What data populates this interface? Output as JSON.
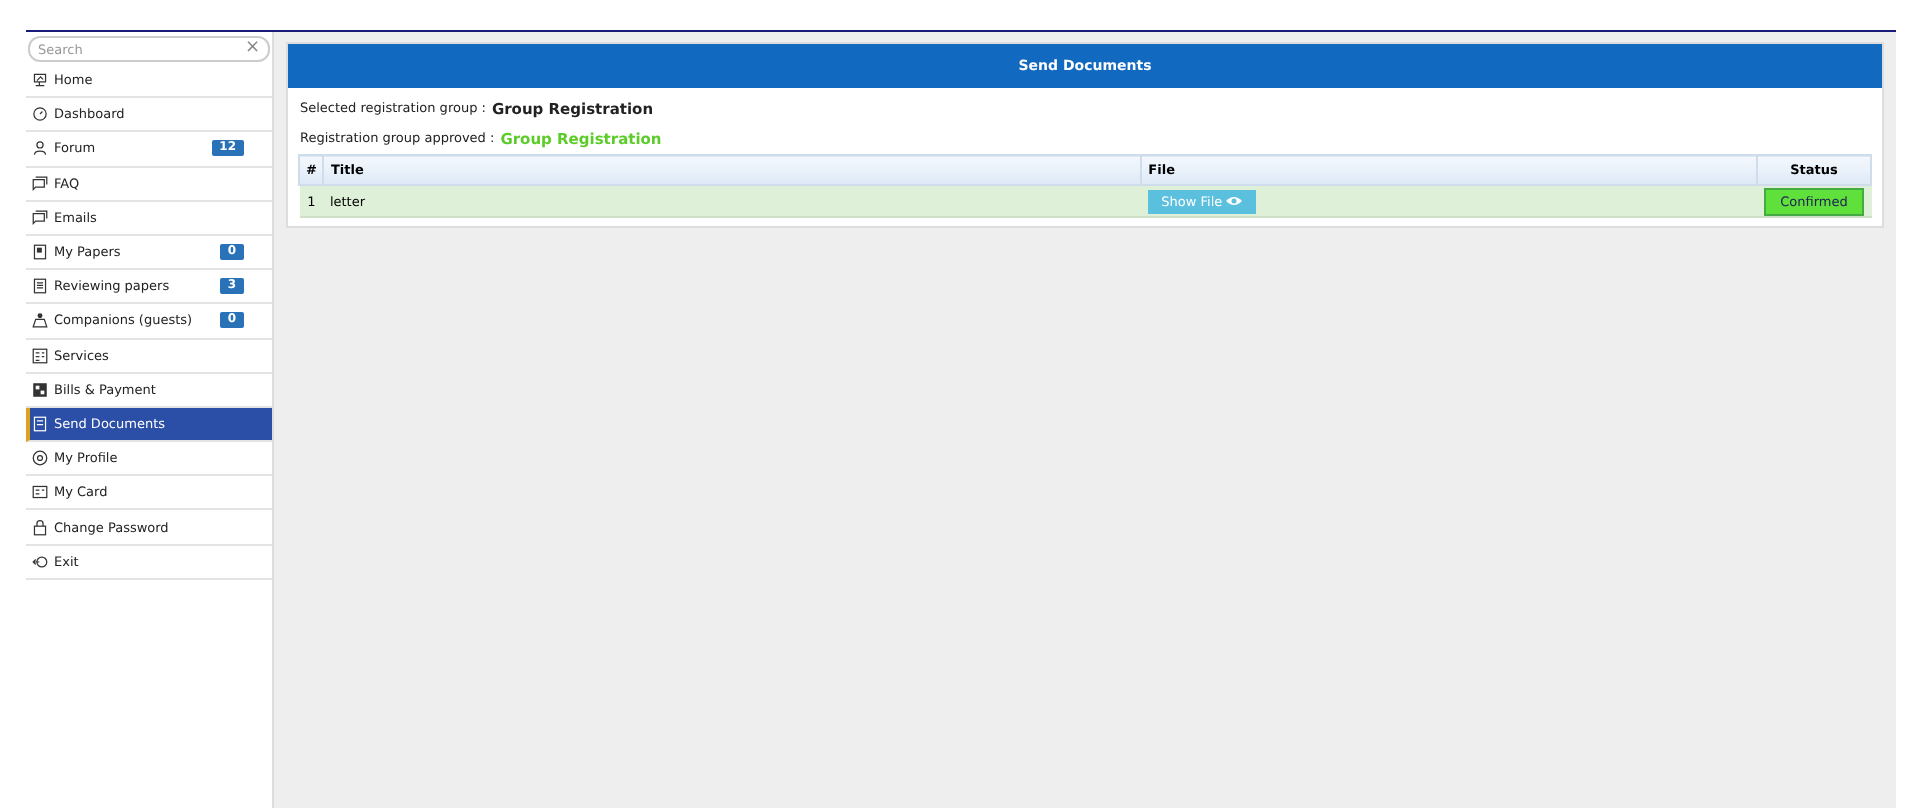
{
  "sidebar": {
    "search": {
      "placeholder": "Search",
      "clear": "×"
    },
    "items": [
      {
        "label": "Home",
        "selected": false
      },
      {
        "label": "Dashboard",
        "selected": false
      },
      {
        "label": "Forum",
        "badge": "12",
        "selected": false
      },
      {
        "label": "FAQ",
        "selected": false
      },
      {
        "label": "Emails",
        "selected": false
      },
      {
        "label": "My Papers",
        "badge": "0",
        "selected": false
      },
      {
        "label": "Reviewing papers",
        "badge": "3",
        "selected": false
      },
      {
        "label": "Companions (guests)",
        "badge": "0",
        "selected": false
      },
      {
        "label": "Services",
        "selected": false
      },
      {
        "label": "Bills & Payment",
        "selected": false
      },
      {
        "label": "Send Documents",
        "selected": true
      },
      {
        "label": "My Profile",
        "selected": false
      },
      {
        "label": "My Card",
        "selected": false
      },
      {
        "label": "Change Password",
        "selected": false
      },
      {
        "label": "Exit",
        "selected": false
      }
    ]
  },
  "panel": {
    "title": "Send Documents",
    "info": [
      {
        "label": "Selected registration group :",
        "value": "Group Registration",
        "approved": false
      },
      {
        "label": "Registration group approved :",
        "value": "Group Registration",
        "approved": true
      }
    ],
    "table": {
      "columns": [
        "#",
        "Title",
        "File",
        "Status"
      ],
      "rows": [
        {
          "number": "1",
          "title": "letter",
          "file_button": "Show File",
          "status": "Confirmed",
          "confirmed": true
        }
      ]
    }
  }
}
